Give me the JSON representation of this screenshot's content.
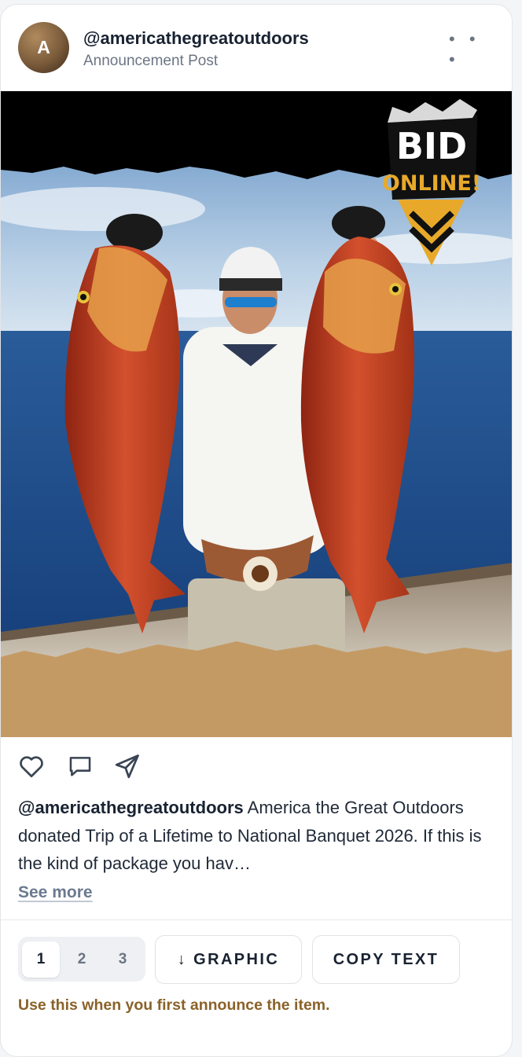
{
  "post": {
    "avatar_letter": "A",
    "handle": "@americathegreatoutdoors",
    "subtitle": "Announcement Post",
    "more_label": "• • •"
  },
  "media": {
    "badge_line1": "BID",
    "badge_line2": "ONLINE!",
    "colors": {
      "top_band": "#000000",
      "bottom_band": "#c49a64",
      "sky": "#9fc0df",
      "sea": "#1f4f8f",
      "badge_gold": "#e8a92a"
    }
  },
  "actions": {
    "icons": [
      "heart-icon",
      "comment-icon",
      "send-icon"
    ]
  },
  "caption": {
    "handle": "@americathegreatoutdoors",
    "text": " America the Great Outdoors donated Trip of a Lifetime to National Banquet 2026. If this is the kind of package you hav…",
    "see_more": "See more"
  },
  "controls": {
    "pages": [
      "1",
      "2",
      "3"
    ],
    "active_page": "1",
    "graphic_button": "↓ GRAPHIC",
    "copy_button": "COPY TEXT",
    "hint": "Use this when you first announce the item."
  }
}
